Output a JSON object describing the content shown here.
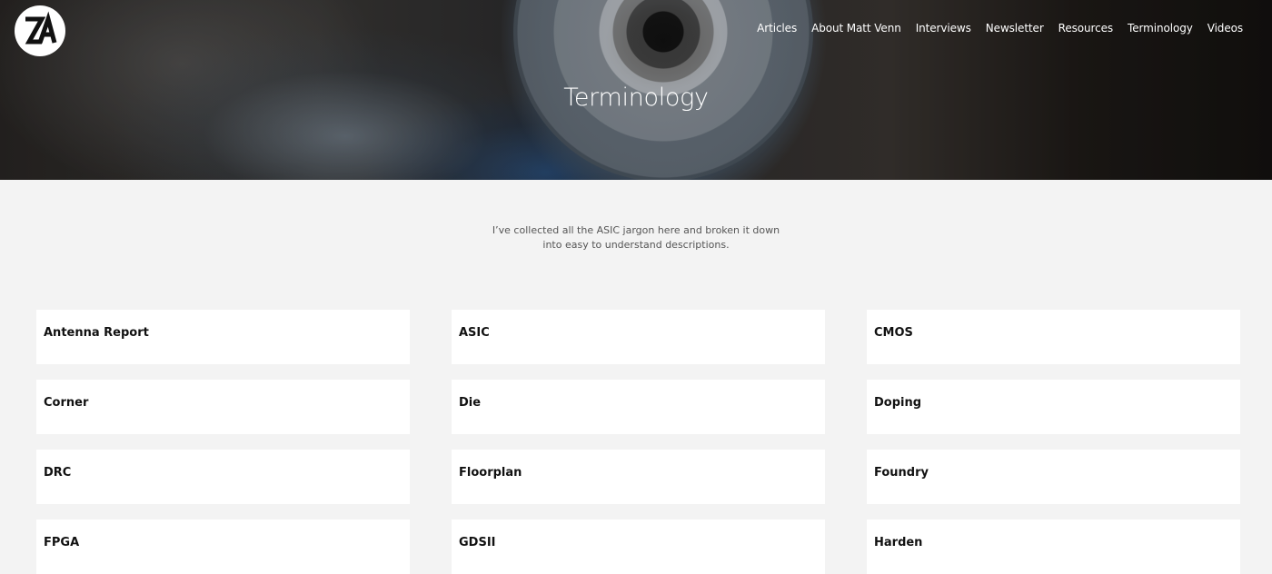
{
  "header": {
    "logo_icon": "za-logo-icon",
    "nav": [
      {
        "label": "Articles"
      },
      {
        "label": "About Matt Venn"
      },
      {
        "label": "Interviews"
      },
      {
        "label": "Newsletter"
      },
      {
        "label": "Resources"
      },
      {
        "label": "Terminology"
      },
      {
        "label": "Videos"
      }
    ],
    "title": "Terminology"
  },
  "intro": {
    "line1": "I’ve collected all the ASIC jargon here and broken it down",
    "line2": "into easy to understand descriptions."
  },
  "terms": [
    {
      "label": "Antenna Report"
    },
    {
      "label": "ASIC"
    },
    {
      "label": "CMOS"
    },
    {
      "label": "Corner"
    },
    {
      "label": "Die"
    },
    {
      "label": "Doping"
    },
    {
      "label": "DRC"
    },
    {
      "label": "Floorplan"
    },
    {
      "label": "Foundry"
    },
    {
      "label": "FPGA"
    },
    {
      "label": "GDSII"
    },
    {
      "label": "Harden"
    }
  ],
  "colors": {
    "background": "#f3f3f3",
    "card": "#ffffff",
    "text": "#111111"
  }
}
